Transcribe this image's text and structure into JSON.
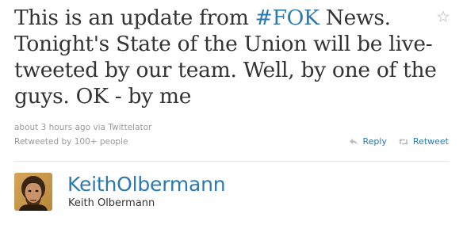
{
  "tweet": {
    "text_before": "This is an update from ",
    "hashtag": "#FOK",
    "text_after": " News. Tonight's State of the Union will be live-tweeted by our team. Well, by one of the guys. OK - by me",
    "time": "about 3 hours ago",
    "via_prefix": "via",
    "source": "Twittelator",
    "retweeted_by": "Retweeted by 100+ people"
  },
  "actions": {
    "reply_label": "Reply",
    "retweet_label": "Retweet"
  },
  "author": {
    "screen_name": "KeithOlbermann",
    "full_name": "Keith Olbermann"
  },
  "icons": {
    "favorite": "star-icon",
    "reply": "reply-arrow-icon",
    "retweet": "retweet-arrows-icon",
    "avatar": "avatar"
  },
  "colors": {
    "link": "#2a7ab0",
    "text": "#333333",
    "meta": "#999999"
  }
}
